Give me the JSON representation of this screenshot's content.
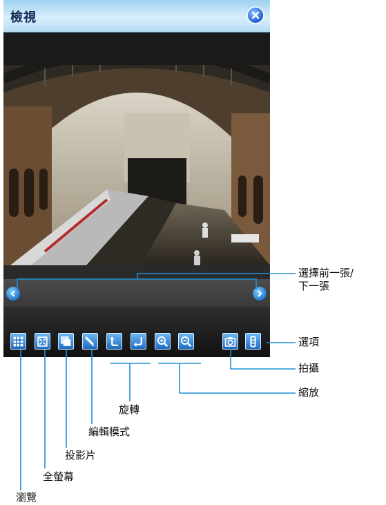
{
  "window": {
    "title": "檢視",
    "close_icon": "close-icon"
  },
  "photo": {
    "subject": "train-station-photo"
  },
  "navigation": {
    "prev_icon": "chevron-left-icon",
    "next_icon": "chevron-right-icon"
  },
  "toolbar": {
    "tools": [
      {
        "icon": "grid-icon"
      },
      {
        "icon": "fullscreen-icon"
      },
      {
        "icon": "slideshow-icon"
      },
      {
        "icon": "pen-icon"
      },
      {
        "icon": "rotate-left-icon"
      },
      {
        "icon": "rotate-right-icon"
      },
      {
        "icon": "zoom-in-icon"
      },
      {
        "icon": "zoom-out-icon"
      },
      {
        "icon": "camera-icon"
      },
      {
        "icon": "options-icon"
      }
    ]
  },
  "callouts": {
    "prev_next_line1": "選擇前一張/",
    "prev_next_line2": "下一張",
    "options": "選項",
    "capture": "拍攝",
    "zoom": "縮放",
    "rotate": "旋轉",
    "edit_mode": "編輯模式",
    "slideshow": "投影片",
    "fullscreen": "全螢幕",
    "browse": "瀏覽"
  },
  "colors": {
    "title_bar": "#b7dcf3",
    "tool_button": "#1d6cc4",
    "callout_line": "#1f8ed6"
  }
}
